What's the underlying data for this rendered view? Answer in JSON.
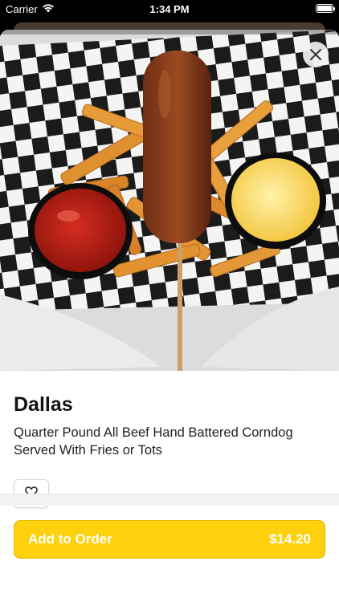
{
  "status_bar": {
    "carrier": "Carrier",
    "time": "1:34 PM",
    "icons": [
      "wifi-icon",
      "battery-icon"
    ]
  },
  "hero": {
    "image": "corndog-with-fries-ketchup-mustard-photo",
    "close_icon": "close-icon"
  },
  "item": {
    "title": "Dallas",
    "description": "Quarter Pound All Beef Hand Battered Corndog Served With Fries or Tots",
    "favorite_icon": "heart-icon"
  },
  "order_button": {
    "label": "Add to Order",
    "price": "$14.20"
  },
  "colors": {
    "accent": "#ffd00d",
    "accent_text": "#ffffff",
    "title": "#111111",
    "background": "#ffffff"
  }
}
